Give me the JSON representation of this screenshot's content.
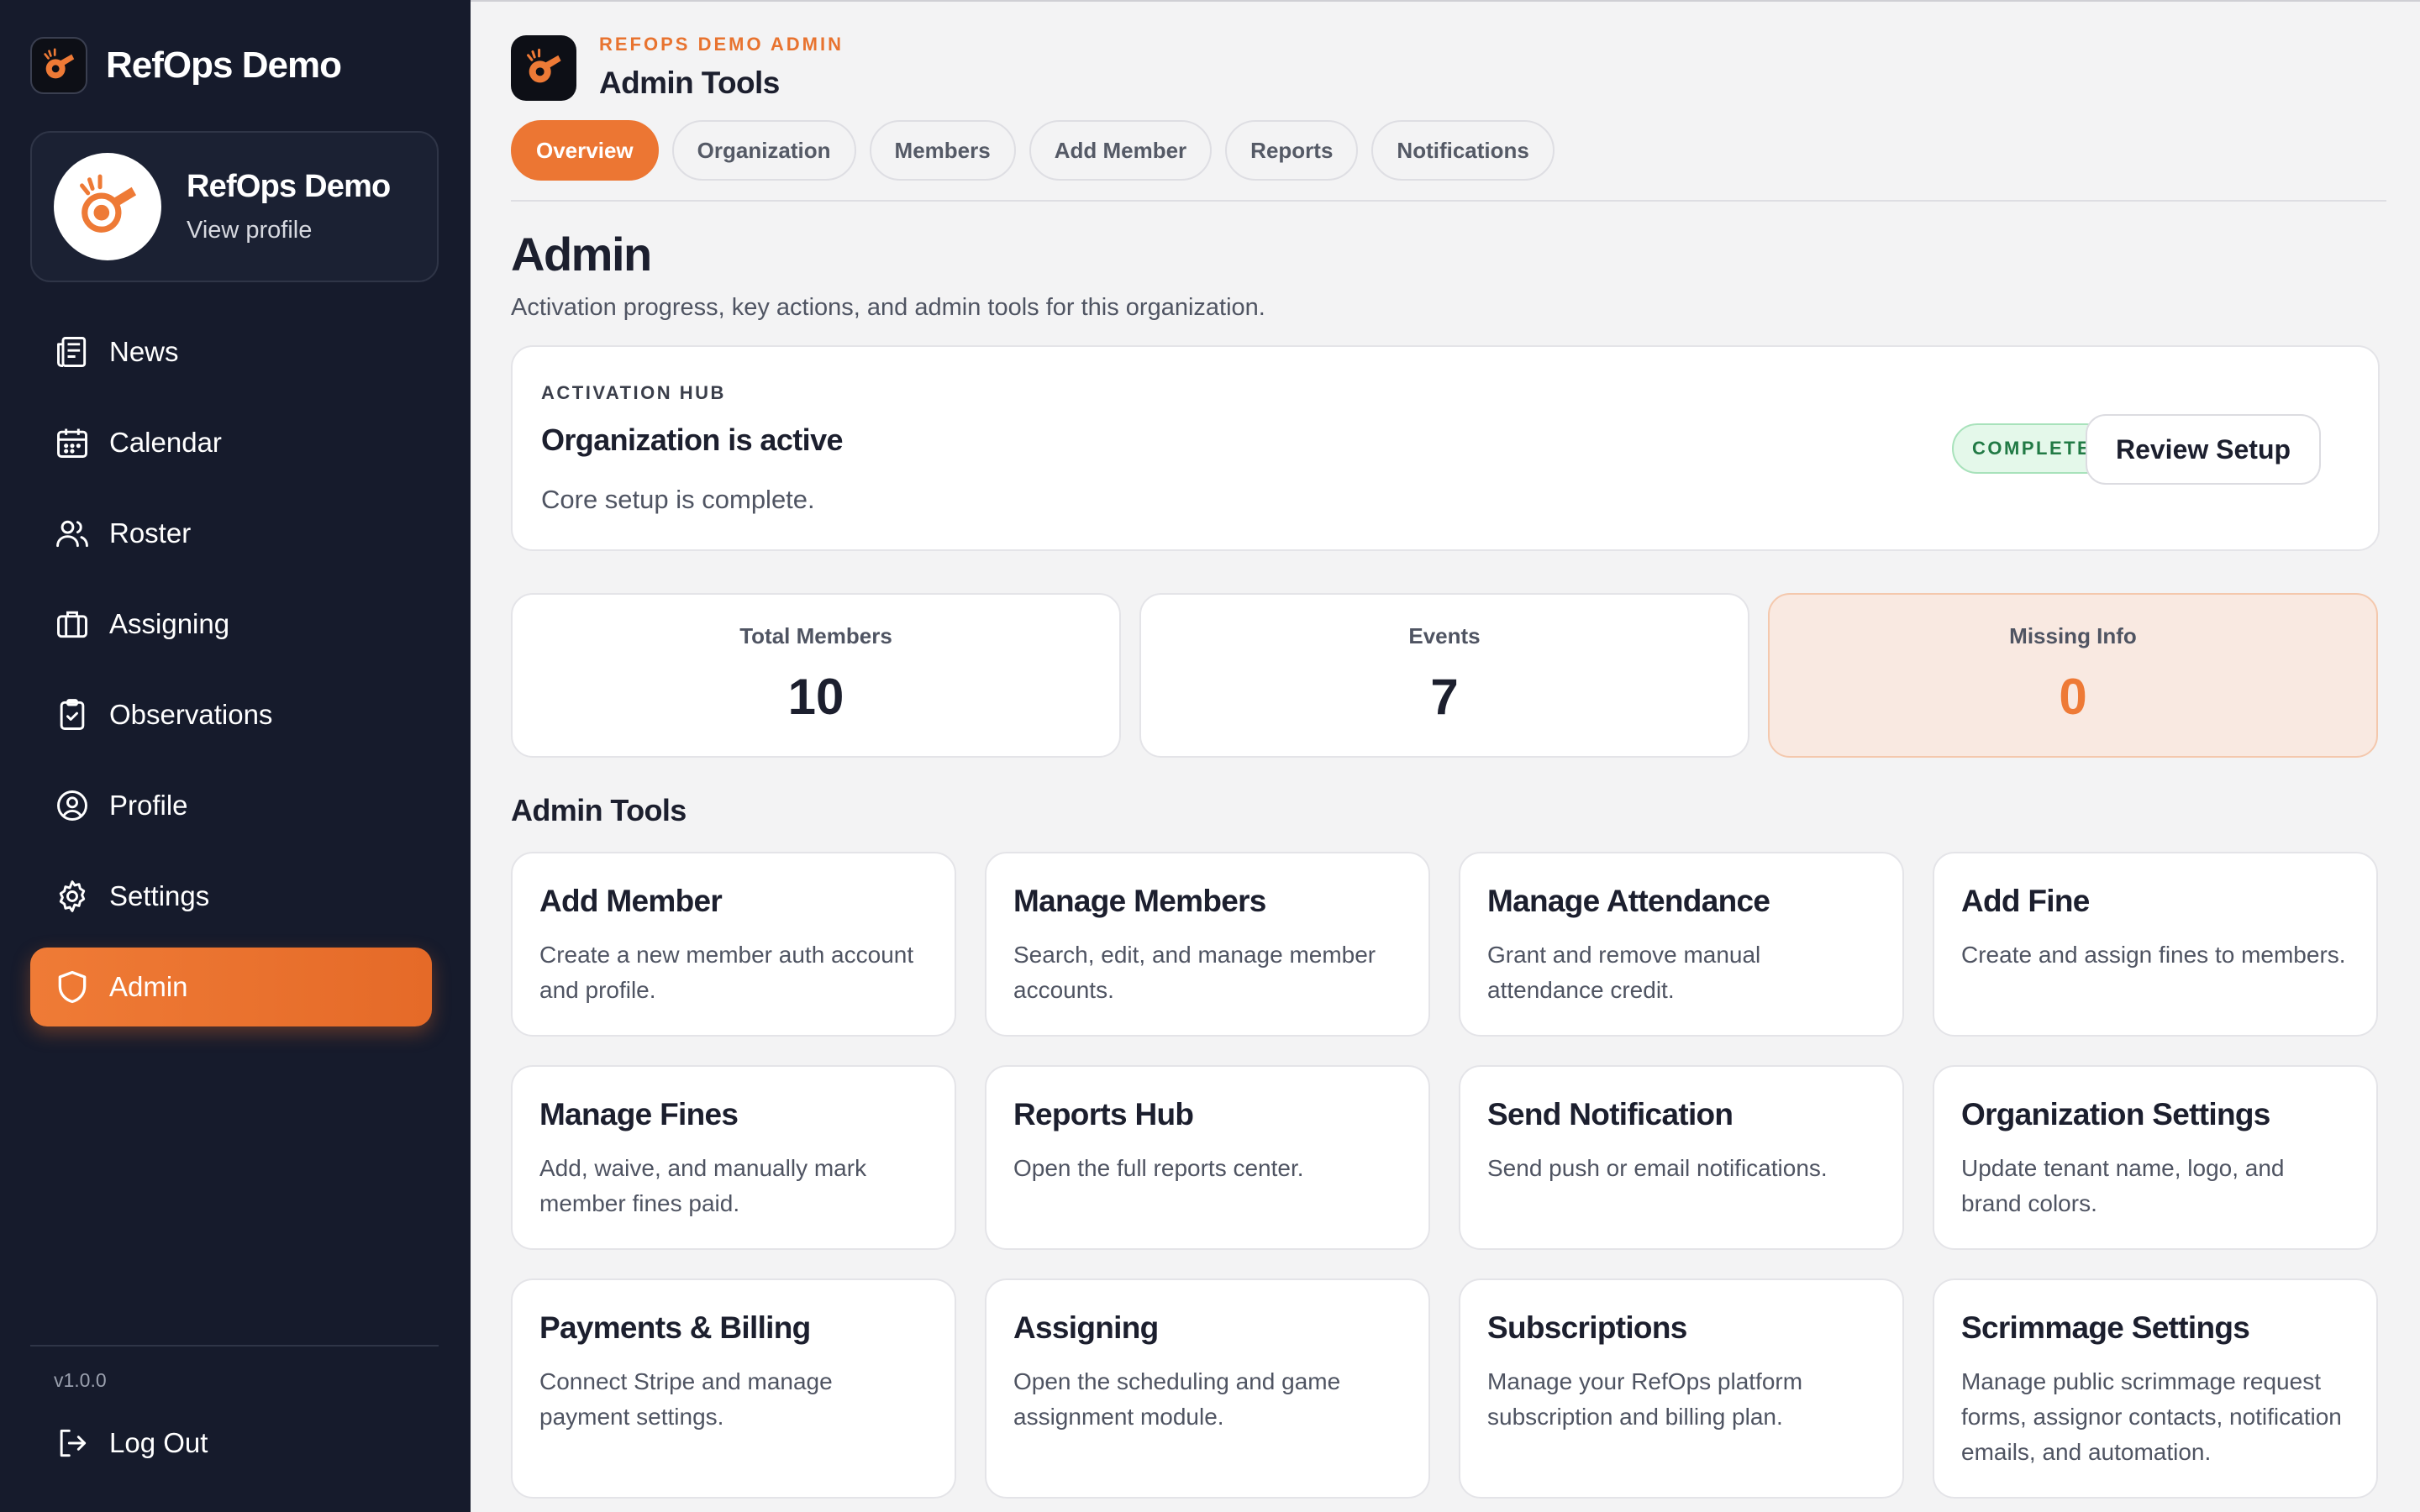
{
  "app": {
    "name": "RefOps Demo"
  },
  "sidebar": {
    "profile": {
      "name": "RefOps Demo",
      "link": "View profile"
    },
    "items": [
      {
        "label": "News",
        "icon": "newspaper-icon"
      },
      {
        "label": "Calendar",
        "icon": "calendar-icon"
      },
      {
        "label": "Roster",
        "icon": "users-icon"
      },
      {
        "label": "Assigning",
        "icon": "briefcase-icon"
      },
      {
        "label": "Observations",
        "icon": "clipboard-check-icon"
      },
      {
        "label": "Profile",
        "icon": "user-circle-icon"
      },
      {
        "label": "Settings",
        "icon": "gear-icon"
      },
      {
        "label": "Admin",
        "icon": "shield-icon",
        "active": true
      }
    ],
    "version": "v1.0.0",
    "logout": "Log Out"
  },
  "header": {
    "kicker": "REFOPS DEMO ADMIN",
    "title": "Admin Tools"
  },
  "tabs": [
    "Overview",
    "Organization",
    "Members",
    "Add Member",
    "Reports",
    "Notifications"
  ],
  "page": {
    "title": "Admin",
    "subtitle": "Activation progress, key actions, and admin tools for this organization."
  },
  "hub": {
    "kicker": "ACTIVATION HUB",
    "title": "Organization is active",
    "desc": "Core setup is complete.",
    "badge": "COMPLETE",
    "button": "Review Setup"
  },
  "stats": [
    {
      "label": "Total Members",
      "value": "10"
    },
    {
      "label": "Events",
      "value": "7"
    },
    {
      "label": "Missing Info",
      "value": "0"
    }
  ],
  "section": "Admin Tools",
  "tools": [
    {
      "title": "Add Member",
      "desc": "Create a new member auth account and profile."
    },
    {
      "title": "Manage Members",
      "desc": "Search, edit, and manage member accounts."
    },
    {
      "title": "Manage Attendance",
      "desc": "Grant and remove manual attendance credit."
    },
    {
      "title": "Add Fine",
      "desc": "Create and assign fines to members."
    },
    {
      "title": "Manage Fines",
      "desc": "Add, waive, and manually mark member fines paid."
    },
    {
      "title": "Reports Hub",
      "desc": "Open the full reports center."
    },
    {
      "title": "Send Notification",
      "desc": "Send push or email notifications."
    },
    {
      "title": "Organization Settings",
      "desc": "Update tenant name, logo, and brand colors."
    },
    {
      "title": "Payments & Billing",
      "desc": "Connect Stripe and manage payment settings."
    },
    {
      "title": "Assigning",
      "desc": "Open the scheduling and game assignment module."
    },
    {
      "title": "Subscriptions",
      "desc": "Manage your RefOps platform subscription and billing plan."
    },
    {
      "title": "Scrimmage Settings",
      "desc": "Manage public scrimmage request forms, assignor contacts, notification emails, and automation."
    }
  ],
  "colors": {
    "accent": "#ec7633",
    "sidebar": "#161b2c",
    "success": "#217a45"
  }
}
